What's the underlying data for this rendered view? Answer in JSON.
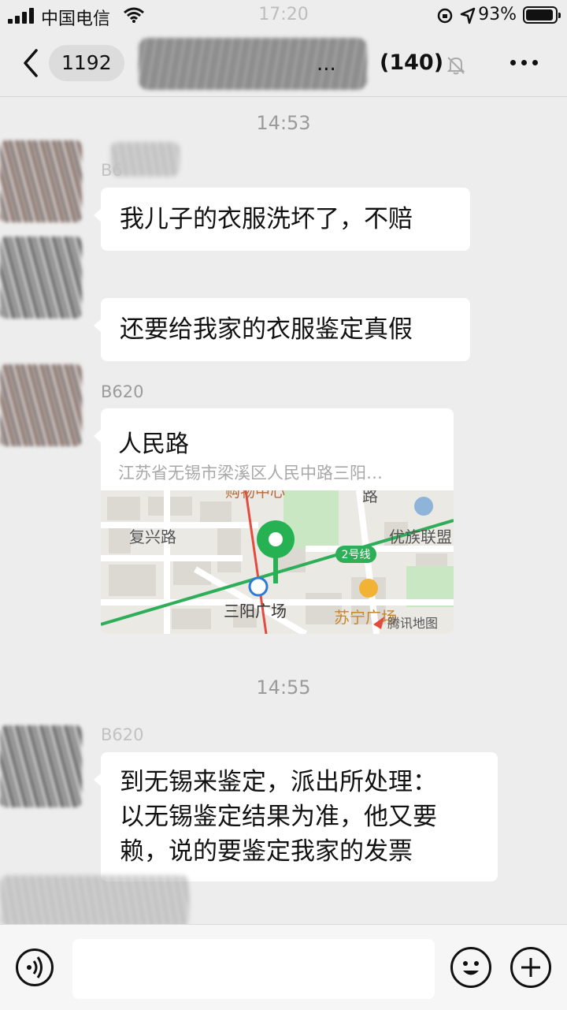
{
  "status_bar": {
    "carrier": "中国电信",
    "time": "17:20",
    "battery_percent": "93%"
  },
  "nav": {
    "unread_count": "1192",
    "title_suffix": "...",
    "member_count": "(140)"
  },
  "messages": [
    {
      "type": "timestamp",
      "text": "14:53"
    },
    {
      "type": "sender",
      "text": "B6"
    },
    {
      "type": "text",
      "text": "我儿子的衣服洗坏了，不赔"
    },
    {
      "type": "text",
      "text": "还要给我家的衣服鉴定真假"
    },
    {
      "type": "sender",
      "text": "B620"
    },
    {
      "type": "location",
      "name": "人民路",
      "address": "江苏省无锡市梁溪区人民中路三阳…",
      "map_labels": {
        "top": "购物中心",
        "road_west": "复兴路",
        "road_north": "路",
        "brand": "优族联盟",
        "metro_line": "2号线",
        "station": "三阳广场",
        "mall": "苏宁广场",
        "provider": "腾讯地图"
      }
    },
    {
      "type": "timestamp",
      "text": "14:55"
    },
    {
      "type": "sender",
      "text": "B620"
    },
    {
      "type": "text",
      "lines": [
        "到无锡来鉴定，派出所处理：",
        "以无锡鉴定结果为准，他又要",
        "赖，说的要鉴定我家的发票"
      ]
    }
  ],
  "colors": {
    "background": "#ededed",
    "bubble": "#ffffff",
    "metro_green": "#2fae5a",
    "pin_green": "#26b253"
  },
  "icons": [
    "signal-icon",
    "wifi-icon",
    "rotation-lock-icon",
    "location-arrow-icon",
    "battery-icon",
    "back-chevron-icon",
    "mute-bell-icon",
    "more-icon",
    "voice-icon",
    "emoji-icon",
    "plus-icon",
    "map-pin-icon",
    "metro-icon",
    "bank-icon",
    "mall-icon",
    "tencent-map-logo-icon"
  ]
}
